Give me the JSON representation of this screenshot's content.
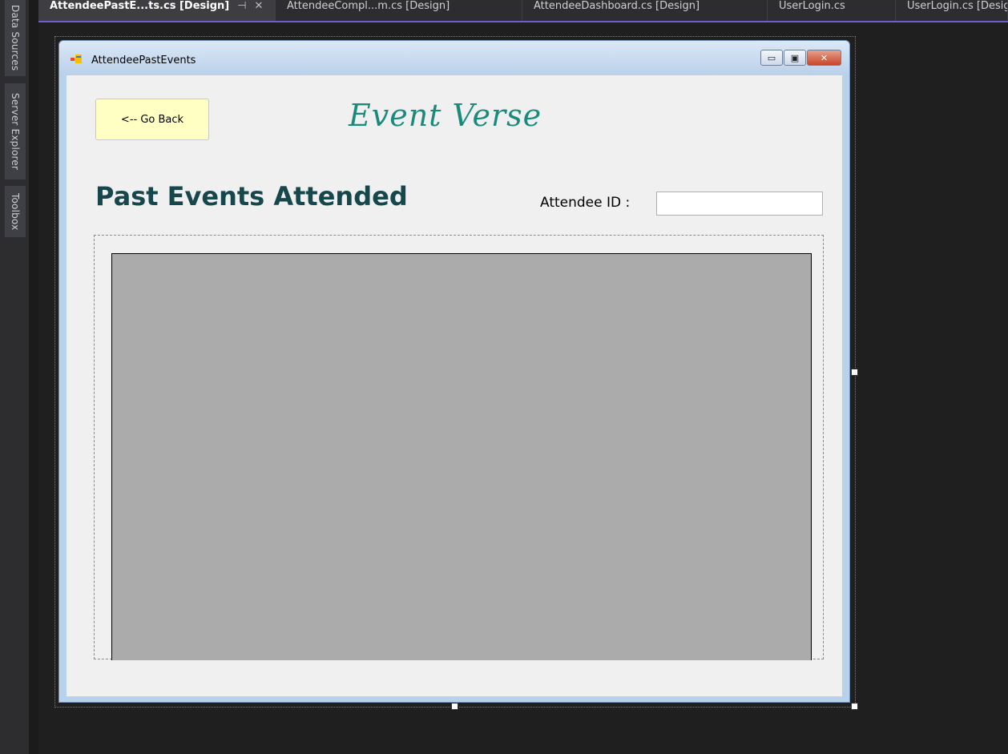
{
  "side_tabs": [
    {
      "label": "Data Sources"
    },
    {
      "label": "Server Explorer"
    },
    {
      "label": "Toolbox"
    }
  ],
  "doc_tabs": [
    {
      "label": "AttendeePastE...ts.cs [Design]",
      "pin": "⊣",
      "close": "✕"
    },
    {
      "label": "AttendeeCompl...m.cs [Design]"
    },
    {
      "label": "AttendeeDashboard.cs [Design]"
    },
    {
      "label": "UserLogin.cs"
    },
    {
      "label": "UserLogin.cs [Design]"
    }
  ],
  "form": {
    "title": "AttendeePastEvents",
    "window_buttons": {
      "minimize": "▭",
      "maximize": "▣",
      "close": "✕"
    },
    "go_back_label": "<-- Go Back",
    "brand": "Event Verse",
    "heading": "Past Events Attended",
    "attendee_id_label": "Attendee ID :",
    "attendee_id_value": ""
  },
  "colors": {
    "ide_background": "#1e1e1e",
    "active_tab_underline": "#6c5fd2",
    "go_back_bg": "#ffffc4",
    "brand_color": "#1a8a7d",
    "heading_color": "#16474c",
    "grid_bg": "#ababab"
  }
}
